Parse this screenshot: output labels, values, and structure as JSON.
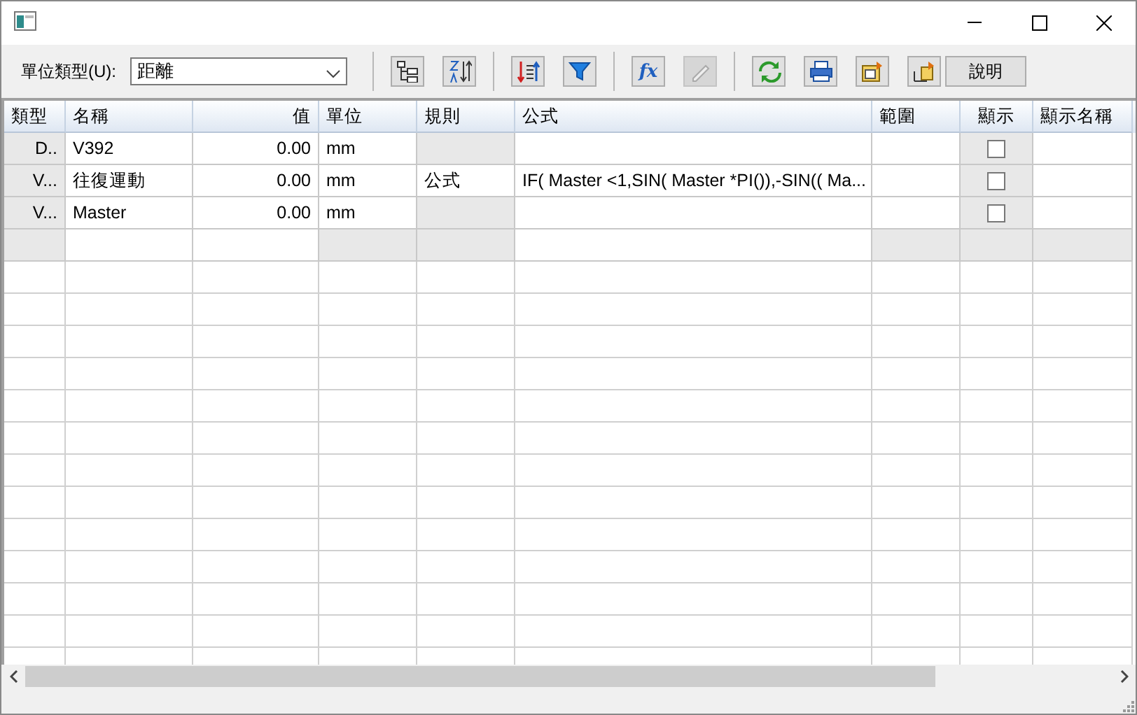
{
  "toolbar": {
    "unit_label": "單位類型(U):",
    "unit_value": "距離",
    "groups": [
      [
        {
          "kind": "tree",
          "disabled": false
        },
        {
          "kind": "sort",
          "disabled": false
        }
      ],
      [
        {
          "kind": "order",
          "disabled": false
        },
        {
          "kind": "filter",
          "disabled": false
        }
      ],
      [
        {
          "kind": "text",
          "label": "fx",
          "disabled": false
        },
        {
          "kind": "pen",
          "disabled": true
        }
      ],
      [
        {
          "kind": "refresh",
          "disabled": false
        },
        {
          "kind": "print",
          "disabled": false
        },
        {
          "kind": "export",
          "disabled": false
        },
        {
          "kind": "import",
          "disabled": false
        },
        {
          "kind": "button",
          "label": "說明",
          "disabled": false
        }
      ]
    ]
  },
  "table": {
    "columns": [
      "類型",
      "名稱",
      "值",
      "單位",
      "規則",
      "公式",
      "範圍",
      "顯示",
      "顯示名稱"
    ],
    "rows": [
      {
        "type": "D..",
        "name": "V392",
        "value": "0.00",
        "unit": "mm",
        "rule": "",
        "formula": "",
        "shown": false
      },
      {
        "type": "V...",
        "name": "往復運動",
        "value": "0.00",
        "unit": "mm",
        "rule": "公式",
        "formula": "IF( Master <1,SIN( Master *PI()),-SIN(( Ma...",
        "shown": false
      },
      {
        "type": "V...",
        "name": "Master",
        "value": "0.00",
        "unit": "mm",
        "rule": "",
        "formula": "",
        "shown": false
      }
    ]
  }
}
